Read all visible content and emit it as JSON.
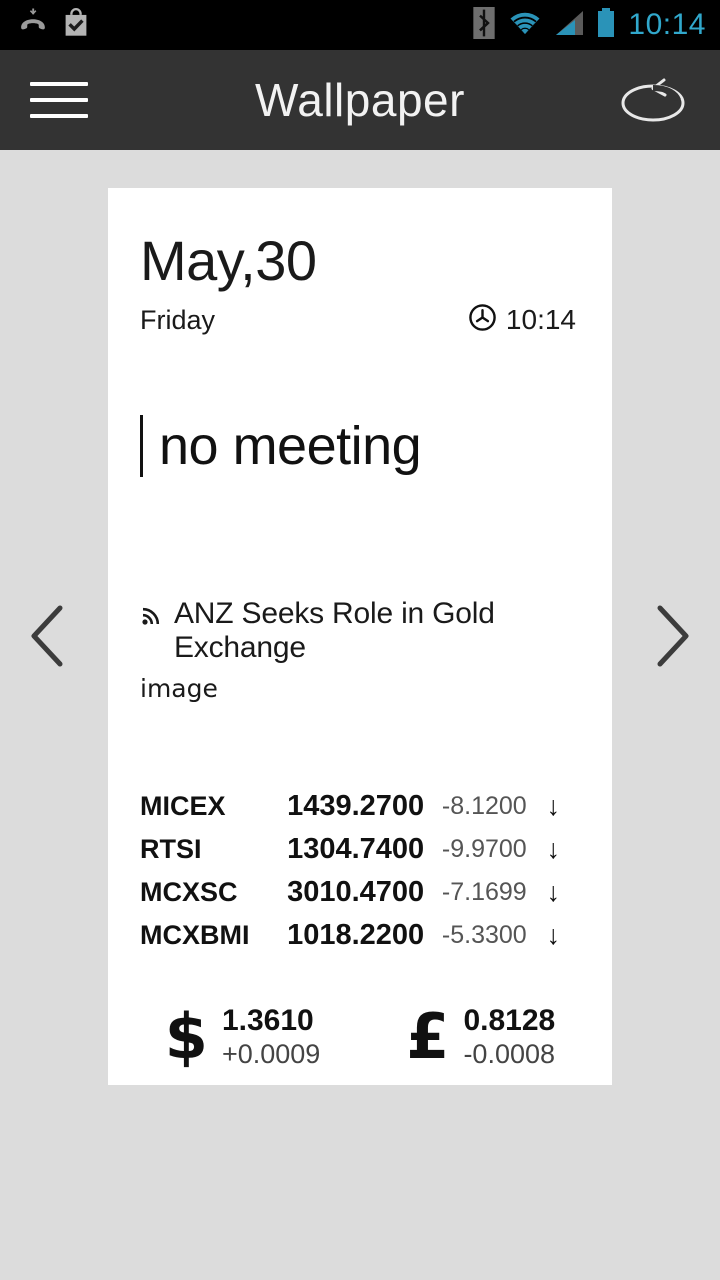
{
  "statusbar": {
    "time": "10:14",
    "time_color": "#31a8cc",
    "icons": [
      {
        "name": "missed-call-icon",
        "label": "missed call"
      },
      {
        "name": "shopping-bag-check-icon",
        "label": "shop update"
      },
      {
        "name": "bluetooth-icon",
        "label": "bluetooth"
      },
      {
        "name": "wifi-icon",
        "label": "wifi"
      },
      {
        "name": "signal-bars-icon",
        "label": "signal"
      },
      {
        "name": "battery-icon",
        "label": "battery"
      }
    ]
  },
  "actionbar": {
    "title": "Wallpaper",
    "menu_icon": "hamburger-menu-icon",
    "refresh_icon": "refresh-rotate-icon",
    "background": "#333333"
  },
  "nav": {
    "prev_icon": "chevron-left-icon",
    "next_icon": "chevron-right-icon"
  },
  "card": {
    "date": "May,30",
    "weekday": "Friday",
    "clock_icon": "clock-icon",
    "clock_time": "10:14",
    "agenda": {
      "text": "no meeting"
    },
    "news": {
      "feed_icon": "rss-icon",
      "headline": "ANZ Seeks Role in Gold Exchange",
      "image_placeholder": "image"
    },
    "quotes": [
      {
        "symbol": "MICEX",
        "value": "1439.2700",
        "change": "-8.1200",
        "arrow": "↓"
      },
      {
        "symbol": "RTSI",
        "value": "1304.7400",
        "change": "-9.9700",
        "arrow": "↓"
      },
      {
        "symbol": "MCXSC",
        "value": "3010.4700",
        "change": "-7.1699",
        "arrow": "↓"
      },
      {
        "symbol": "MCXBMI",
        "value": "1018.2200",
        "change": "-5.3300",
        "arrow": "↓"
      }
    ],
    "currencies": [
      {
        "symbol": "$",
        "name": "dollar-symbol",
        "rate": "1.3610",
        "delta": "+0.0009"
      },
      {
        "symbol": "£",
        "name": "pound-symbol",
        "rate": "0.8128",
        "delta": "-0.0008"
      }
    ]
  },
  "colors": {
    "page_background": "#dcdcdc",
    "card_background": "#ffffff",
    "accent": "#31a8cc"
  }
}
